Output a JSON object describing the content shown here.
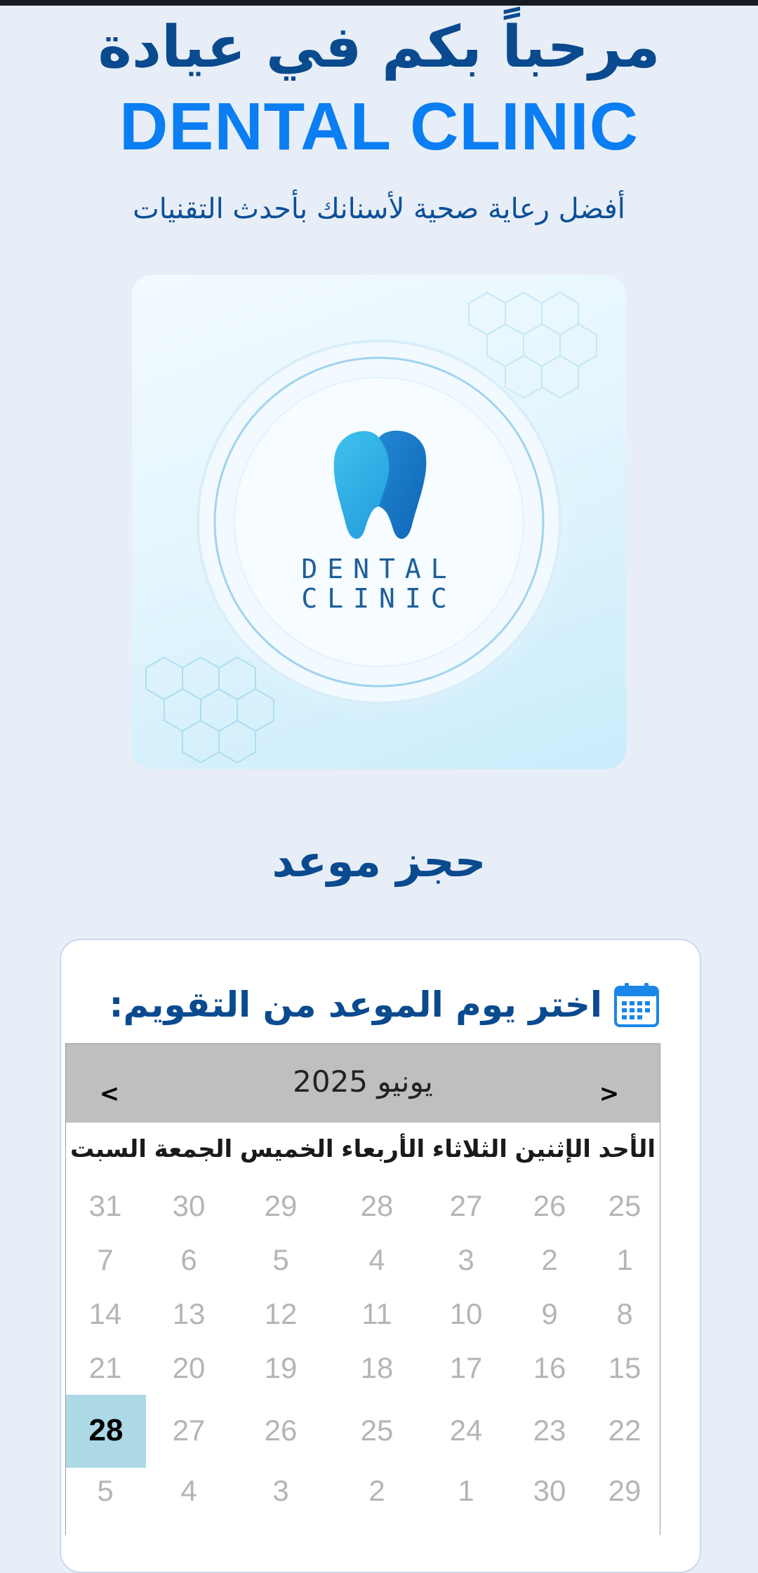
{
  "hero": {
    "title": "مرحباً بكم في عيادة",
    "brand": "DENTAL CLINIC",
    "subtitle": "أفضل رعاية صحية لأسنانك بأحدث التقنيات"
  },
  "logo": {
    "text_line1": "DENTAL",
    "text_line2": "CLINIC"
  },
  "booking": {
    "title": "حجز موعد",
    "pick_label": "اختر يوم الموعد من التقويم:"
  },
  "calendar": {
    "prev": "<",
    "next": ">",
    "month_label": "يونيو 2025",
    "weekdays": [
      "الأحد",
      "الإثنين",
      "الثلاثاء",
      "الأربعاء",
      "الخميس",
      "الجمعة",
      "السبت"
    ],
    "weeks": [
      [
        "25",
        "26",
        "27",
        "28",
        "29",
        "30",
        "31"
      ],
      [
        "1",
        "2",
        "3",
        "4",
        "5",
        "6",
        "7"
      ],
      [
        "8",
        "9",
        "10",
        "11",
        "12",
        "13",
        "14"
      ],
      [
        "15",
        "16",
        "17",
        "18",
        "19",
        "20",
        "21"
      ],
      [
        "22",
        "23",
        "24",
        "25",
        "26",
        "27",
        "28"
      ],
      [
        "29",
        "30",
        "1",
        "2",
        "3",
        "4",
        "5"
      ]
    ],
    "selected_day": "28"
  },
  "colors": {
    "heading": "#0a4a8f",
    "brand": "#0a7ef2",
    "selected_day_bg": "#add8e6",
    "calendar_header_bg": "#bfbfbf"
  }
}
